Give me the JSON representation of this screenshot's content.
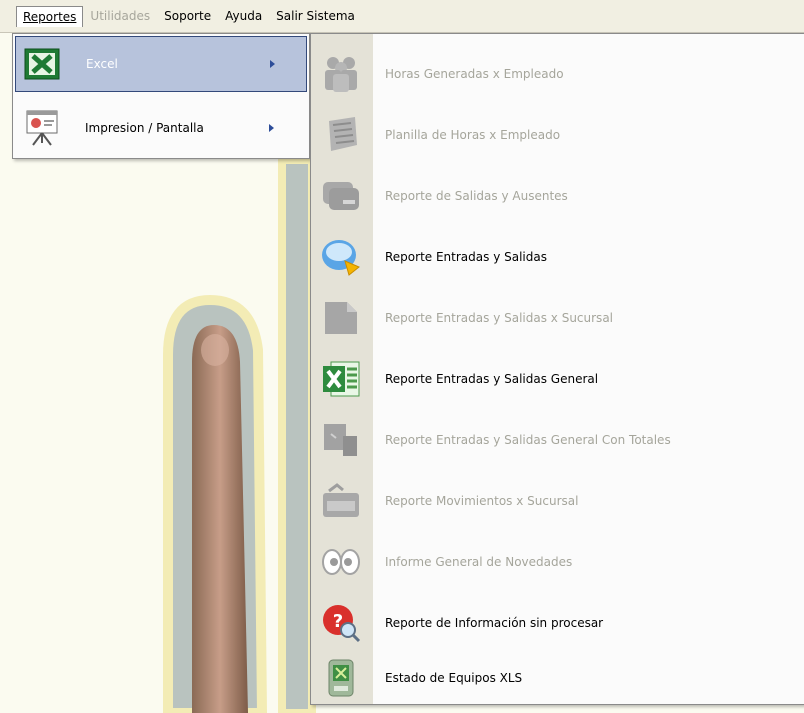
{
  "menubar": {
    "items": [
      {
        "label": "Reportes",
        "underline_first": true,
        "state": "active"
      },
      {
        "label": "Utilidades",
        "underline_first": true,
        "state": "disabled"
      },
      {
        "label": "Soporte",
        "underline_first": false,
        "state": "normal"
      },
      {
        "label": "Ayuda",
        "underline_first": true,
        "state": "normal"
      },
      {
        "label": "Salir Sistema",
        "underline_first": true,
        "state": "normal"
      }
    ]
  },
  "reportes_menu": {
    "items": [
      {
        "label": "Excel",
        "icon": "excel-icon",
        "has_submenu": true,
        "highlighted": true
      },
      {
        "label": "Impresion / Pantalla",
        "icon": "presentation-icon",
        "has_submenu": true,
        "highlighted": false
      }
    ]
  },
  "excel_submenu": {
    "items": [
      {
        "label": "Horas Generadas x Empleado",
        "icon": "people-group-icon",
        "enabled": false
      },
      {
        "label": "Planilla de Horas x Empleado",
        "icon": "spreadsheet-icon",
        "enabled": false
      },
      {
        "label": "Reporte de Salidas y Ausentes",
        "icon": "cards-icon",
        "enabled": false
      },
      {
        "label": "Reporte Entradas y Salidas",
        "icon": "report-chart-icon",
        "enabled": true
      },
      {
        "label": "Reporte Entradas y Salidas x Sucursal",
        "icon": "document-icon",
        "enabled": false
      },
      {
        "label": "Reporte Entradas y Salidas General",
        "icon": "excel-sheet-icon",
        "enabled": true
      },
      {
        "label": "Reporte Entradas y Salidas General Con Totales",
        "icon": "files-icon",
        "enabled": false
      },
      {
        "label": "Reporte Movimientos x Sucursal",
        "icon": "briefcase-icon",
        "enabled": false
      },
      {
        "label": "Informe General de Novedades",
        "icon": "eyes-icon",
        "enabled": false
      },
      {
        "label": "Reporte de Información sin procesar",
        "icon": "search-help-icon",
        "enabled": true
      },
      {
        "label": "Estado de Equipos XLS",
        "icon": "device-excel-icon",
        "enabled": true
      }
    ]
  }
}
